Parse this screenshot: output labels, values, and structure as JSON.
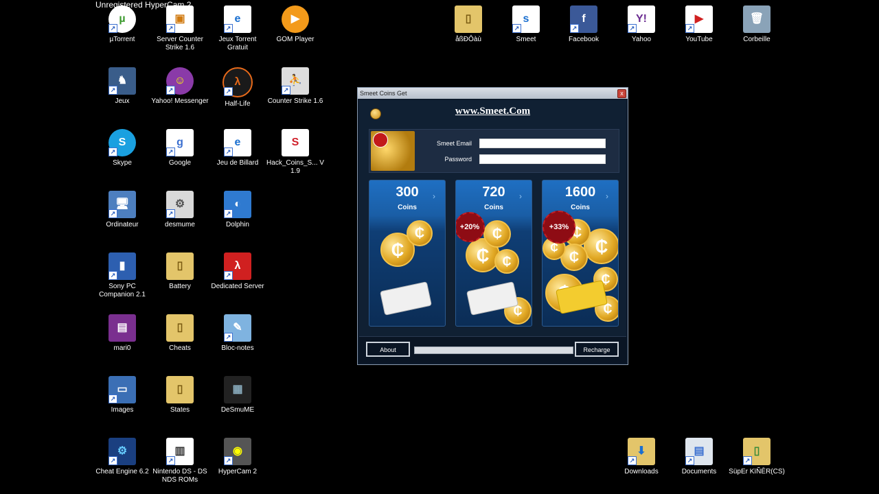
{
  "watermark": "Unregistered HyperCam 2",
  "desktop_icons": {
    "utorrent": "µTorrent",
    "server_cs": "Server Counter Strike 1.6",
    "jeux_torrent": "Jeux Torrent Gratuit",
    "gom_player": "GOM Player",
    "folder_odd": "åßÐÔàù",
    "smeet": "Smeet",
    "facebook": "Facebook",
    "yahoo": "Yahoo",
    "youtube": "YouTube",
    "corbeille": "Corbeille",
    "jeux": "Jeux",
    "yahoo_messenger": "Yahoo! Messenger",
    "half_life": "Half-Life",
    "counter_strike": "Counter Strike 1.6",
    "skype": "Skype",
    "google": "Google",
    "jeu_billard": "Jeu de Billard",
    "hack_coins": "Hack_Coins_S... V 1.9",
    "ordinateur": "Ordinateur",
    "desmume": "desmume",
    "dolphin": "Dolphin",
    "sony_pc": "Sony PC Companion 2.1",
    "battery": "Battery",
    "dedicated_server": "Dedicated Server",
    "mario": "mari0",
    "cheats": "Cheats",
    "bloc_notes": "Bloc-notes",
    "images": "Images",
    "states": "States",
    "desmume2": "DeSmuME",
    "cheat_engine": "Cheat Engine 6.2",
    "nintendo_ds": "Nintendo DS - DS NDS ROMs",
    "hypercam": "HyperCam 2",
    "downloads": "Downloads",
    "documents": "Documents",
    "super": "SüpEr KïÑĒR(CS)"
  },
  "window": {
    "title": "Smeet Coins Get",
    "close_symbol": "x",
    "site_link": "www.Smeet.Com",
    "email_label": "Smeet Email",
    "password_label": "Password",
    "email_value": "",
    "password_value": "",
    "packs": [
      {
        "amount": "300",
        "unit": "Coins",
        "bonus": ""
      },
      {
        "amount": "720",
        "unit": "Coins",
        "bonus": "+20%"
      },
      {
        "amount": "1600",
        "unit": "Coins",
        "bonus": "+33%"
      }
    ],
    "about_button": "About",
    "recharge_button": "Recharge",
    "progress": 0
  },
  "colors": {
    "desktop_bg": "#000000",
    "panel_blue": "#1a5ea6",
    "coin_gold": "#e1a824",
    "bonus_red": "#8e0c14"
  }
}
